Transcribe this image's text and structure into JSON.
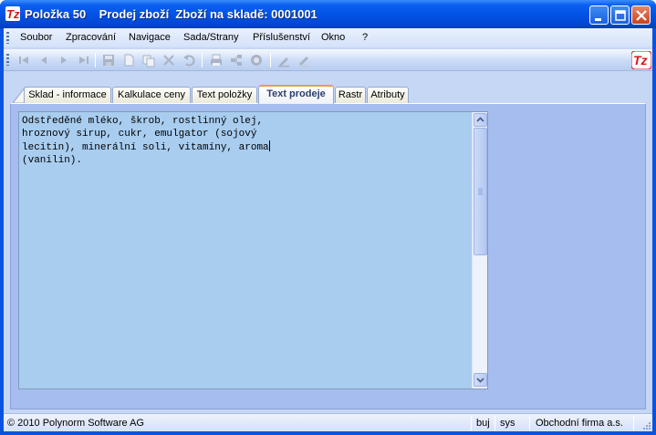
{
  "window": {
    "title": "Položka 50    Prodej zboží  Zboží na skladě: 0001001"
  },
  "colors": {
    "titlebar": "#0254e6",
    "client_bg": "#c6d7f5",
    "panel_bg": "#a6bdf0",
    "editor_bg": "#a9cdef",
    "active_tab_accent": "#e7a03b"
  },
  "menu": {
    "items": [
      {
        "label": "Soubor"
      },
      {
        "label": "Zpracování"
      },
      {
        "label": "Navigace"
      },
      {
        "label": "Sada/Strany"
      },
      {
        "label": "Příslušenství"
      },
      {
        "label": "Okno"
      },
      {
        "label": "?"
      }
    ]
  },
  "toolbar": {
    "icons": [
      "first-record-icon",
      "previous-record-icon",
      "next-record-icon",
      "last-record-icon",
      "save-icon",
      "new-document-icon",
      "copy-icon",
      "delete-icon",
      "undo-icon",
      "print-icon",
      "share-icon",
      "help-icon",
      "edit-icon",
      "edit-clear-icon"
    ],
    "brand_icon": "app-logo-icon"
  },
  "tabs": [
    {
      "label": "Sklad - informace"
    },
    {
      "label": "Kalkulace ceny"
    },
    {
      "label": "Text položky"
    },
    {
      "label": "Text prodeje"
    },
    {
      "label": "Rastr"
    },
    {
      "label": "Atributy"
    }
  ],
  "editor": {
    "text": "Odstředěné mléko, škrob, rostlinný olej,\nhroznový sirup, cukr, emulgator (sojový\nlecitin), minerální soli, vitamíny, aroma",
    "text_tail": "\n(vanilin)."
  },
  "status": {
    "copyright": "© 2010 Polynorm Software AG",
    "mode": "buj",
    "user": "sys",
    "company": "Obchodní firma a.s."
  }
}
